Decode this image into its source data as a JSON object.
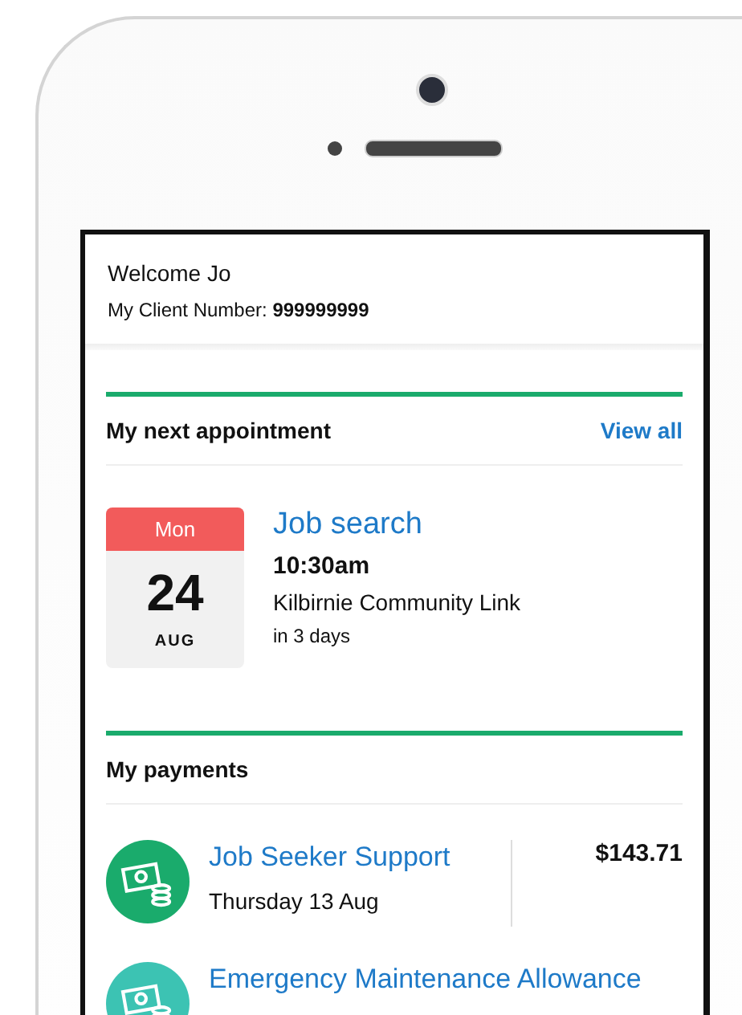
{
  "welcome": {
    "greeting": "Welcome Jo",
    "client_label": "My Client Number: ",
    "client_number": "999999999"
  },
  "appointment": {
    "heading": "My next appointment",
    "view_all": "View all",
    "day": "Mon",
    "date": "24",
    "month": "AUG",
    "title": "Job search",
    "time": "10:30am",
    "place": "Kilbirnie Community Link",
    "relative": "in 3 days"
  },
  "payments": {
    "heading": "My payments",
    "items": [
      {
        "name": "Job Seeker Support",
        "date": "Thursday 13 Aug",
        "amount": "$143.71",
        "color": "#1aab6c"
      },
      {
        "name": "Emergency Maintenance Allowance",
        "color": "#3cc3b3"
      }
    ]
  }
}
